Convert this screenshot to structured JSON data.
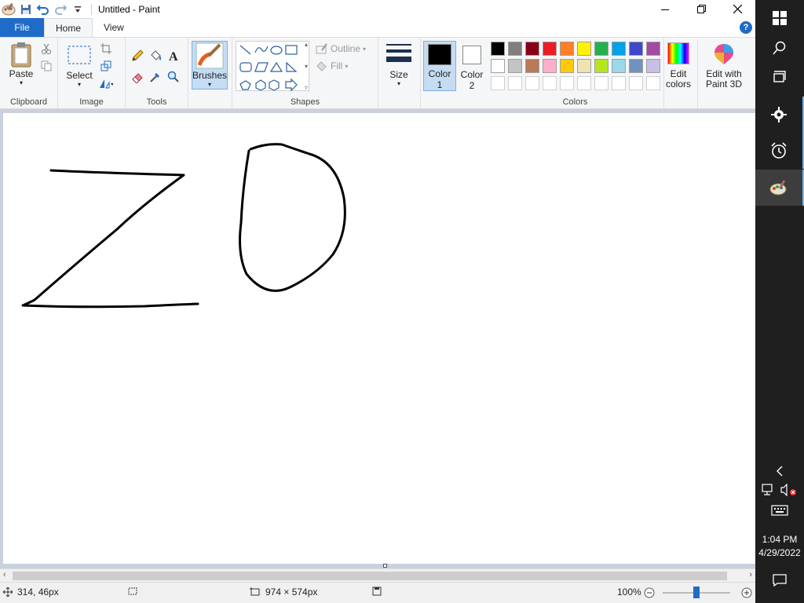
{
  "window": {
    "title": "Untitled - Paint"
  },
  "tabs": {
    "file": "File",
    "home": "Home",
    "view": "View"
  },
  "help_label": "?",
  "ribbon": {
    "clipboard": {
      "paste": "Paste",
      "label": "Clipboard"
    },
    "image": {
      "select": "Select",
      "label": "Image"
    },
    "tools": {
      "label": "Tools"
    },
    "brushes": {
      "label": "Brushes"
    },
    "shapes": {
      "outline": "Outline",
      "fill": "Fill",
      "label": "Shapes"
    },
    "size": {
      "label": "Size"
    },
    "color1": {
      "label": "Color",
      "num": "1",
      "value": "#000000"
    },
    "color2": {
      "label": "Color",
      "num": "2",
      "value": "#ffffff"
    },
    "colors": {
      "label": "Colors"
    },
    "edit_colors": {
      "line1": "Edit",
      "line2": "colors"
    },
    "paint3d": {
      "line1": "Edit with",
      "line2": "Paint 3D"
    }
  },
  "palette": {
    "row1": [
      "#000000",
      "#7f7f7f",
      "#880015",
      "#ed1c24",
      "#ff7f27",
      "#fff200",
      "#22b14c",
      "#00a2e8",
      "#3f48cc",
      "#a349a4"
    ],
    "row2": [
      "#ffffff",
      "#c3c3c3",
      "#b97a57",
      "#ffaec9",
      "#ffc90e",
      "#efe4b0",
      "#b5e61d",
      "#99d9ea",
      "#7092be",
      "#c8bfe7"
    ]
  },
  "canvas": {
    "stroke_color": "#000000"
  },
  "status": {
    "cursor_pos": "314, 46px",
    "canvas_size": "974 × 574px",
    "zoom": "100%",
    "zoom_level": 0.5
  },
  "taskbar": {
    "time": "1:04 PM",
    "date": "4/29/2022"
  }
}
